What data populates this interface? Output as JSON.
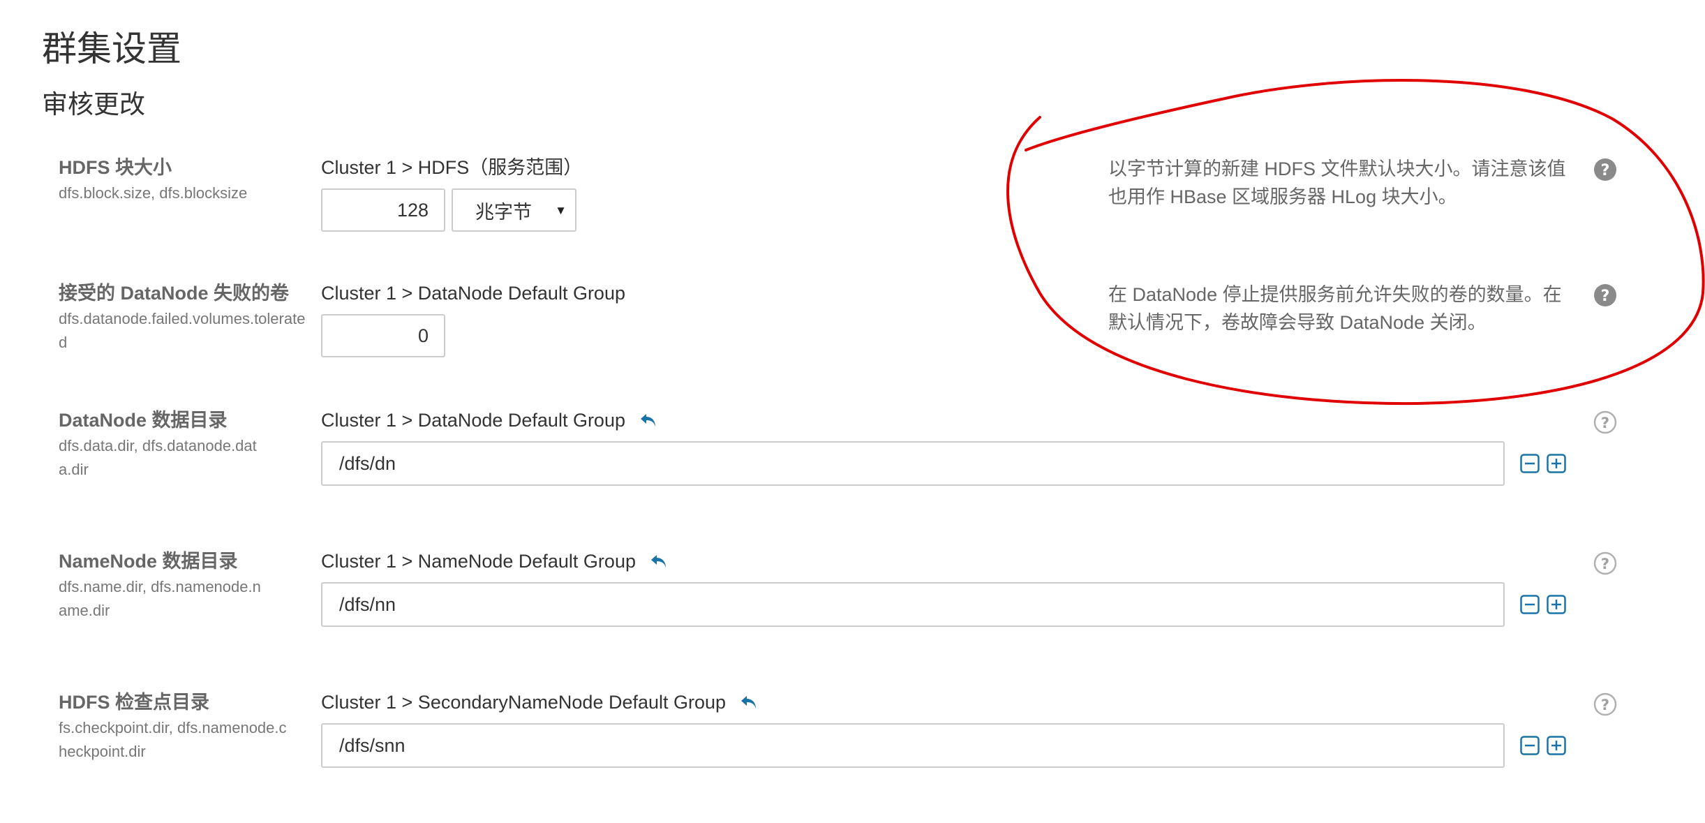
{
  "page": {
    "title": "群集设置",
    "section_title": "审核更改"
  },
  "properties": [
    {
      "name": "HDFS 块大小",
      "keys": "dfs.block.size, dfs.blocksize",
      "scope": "Cluster 1 > HDFS（服务范围）",
      "value": "128",
      "unit": "兆字节",
      "description": "以字节计算的新建 HDFS 文件默认块大小。请注意该值也用作 HBase 区域服务器 HLog 块大小。"
    },
    {
      "name": "接受的 DataNode 失败的卷",
      "keys": "dfs.datanode.failed.volumes.tolerated",
      "scope": "Cluster 1 > DataNode Default Group",
      "value": "0",
      "description": "在 DataNode 停止提供服务前允许失败的卷的数量。在默认情况下，卷故障会导致 DataNode 关闭。"
    },
    {
      "name": "DataNode 数据目录",
      "keys": "dfs.data.dir, dfs.datanode.data.dir",
      "scope": "Cluster 1 > DataNode Default Group",
      "value": "/dfs/dn"
    },
    {
      "name": "NameNode 数据目录",
      "keys": "dfs.name.dir, dfs.namenode.name.dir",
      "scope": "Cluster 1 > NameNode Default Group",
      "value": "/dfs/nn"
    },
    {
      "name": "HDFS 检查点目录",
      "keys": "fs.checkpoint.dir, dfs.namenode.checkpoint.dir",
      "scope": "Cluster 1 > SecondaryNameNode Default Group",
      "value": "/dfs/snn"
    }
  ],
  "icons": {
    "undo": "undo-icon",
    "help": "question-circle-icon",
    "remove": "minus-square-icon",
    "add": "plus-square-icon"
  },
  "colors": {
    "accent": "#1a73a8",
    "annotation": "#e00000",
    "help_icon": "#8a8a8a",
    "help_icon_outline": "#b0b0b0"
  }
}
